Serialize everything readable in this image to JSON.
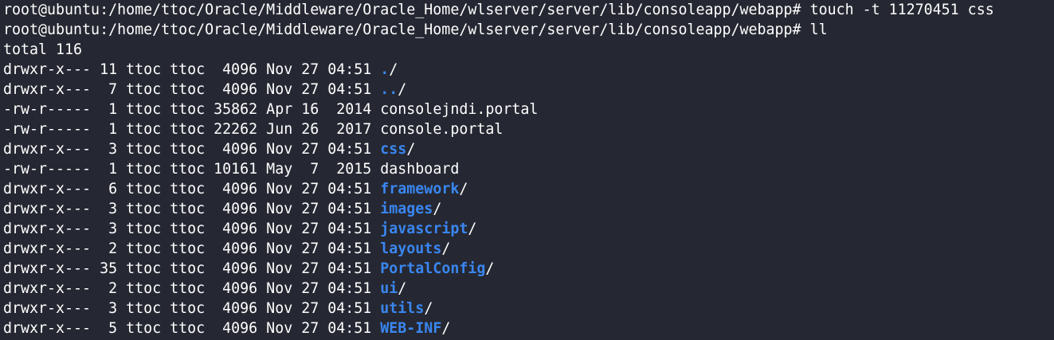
{
  "colors": {
    "background": "#252832",
    "text": "#ffffff",
    "directory": "#3a86f0"
  },
  "commands": [
    "root@ubuntu:/home/ttoc/Oracle/Middleware/Oracle_Home/wlserver/server/lib/consoleapp/webapp# touch -t 11270451 css",
    "root@ubuntu:/home/ttoc/Oracle/Middleware/Oracle_Home/wlserver/server/lib/consoleapp/webapp# ll"
  ],
  "total_line": "total 116",
  "listing": [
    {
      "meta": "drwxr-x--- 11 ttoc ttoc  4096 Nov 27 04:51 ",
      "name": ".",
      "suffix": "/"
    },
    {
      "meta": "drwxr-x---  7 ttoc ttoc  4096 Nov 27 04:51 ",
      "name": "..",
      "suffix": "/"
    },
    {
      "meta": "-rw-r-----  1 ttoc ttoc 35862 Apr 16  2014 ",
      "name": "consolejndi.portal",
      "suffix": ""
    },
    {
      "meta": "-rw-r-----  1 ttoc ttoc 22262 Jun 26  2017 ",
      "name": "console.portal",
      "suffix": ""
    },
    {
      "meta": "drwxr-x---  3 ttoc ttoc  4096 Nov 27 04:51 ",
      "name": "css",
      "suffix": "/"
    },
    {
      "meta": "-rw-r-----  1 ttoc ttoc 10161 May  7  2015 ",
      "name": "dashboard",
      "suffix": ""
    },
    {
      "meta": "drwxr-x---  6 ttoc ttoc  4096 Nov 27 04:51 ",
      "name": "framework",
      "suffix": "/"
    },
    {
      "meta": "drwxr-x---  3 ttoc ttoc  4096 Nov 27 04:51 ",
      "name": "images",
      "suffix": "/"
    },
    {
      "meta": "drwxr-x---  3 ttoc ttoc  4096 Nov 27 04:51 ",
      "name": "javascript",
      "suffix": "/"
    },
    {
      "meta": "drwxr-x---  2 ttoc ttoc  4096 Nov 27 04:51 ",
      "name": "layouts",
      "suffix": "/"
    },
    {
      "meta": "drwxr-x--- 35 ttoc ttoc  4096 Nov 27 04:51 ",
      "name": "PortalConfig",
      "suffix": "/"
    },
    {
      "meta": "drwxr-x---  2 ttoc ttoc  4096 Nov 27 04:51 ",
      "name": "ui",
      "suffix": "/"
    },
    {
      "meta": "drwxr-x---  3 ttoc ttoc  4096 Nov 27 04:51 ",
      "name": "utils",
      "suffix": "/"
    },
    {
      "meta": "drwxr-x---  5 ttoc ttoc  4096 Nov 27 04:51 ",
      "name": "WEB-INF",
      "suffix": "/"
    }
  ]
}
